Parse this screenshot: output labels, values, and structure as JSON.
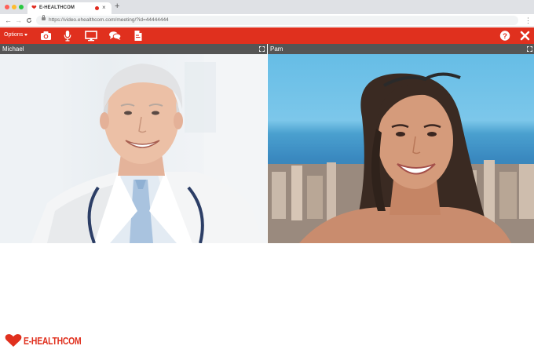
{
  "browser": {
    "tab_title": "E-HEALTHCOM",
    "tab_close": "×",
    "new_tab": "+",
    "url": "https://video.ehealthcom.com/meeting/?id=44444444",
    "menu": "⋮",
    "nav": {
      "back": "←",
      "forward": "→",
      "reload": "C"
    }
  },
  "toolbar": {
    "options_label": "Options",
    "icons": [
      "camera-icon",
      "microphone-icon",
      "screen-share-icon",
      "chat-icon",
      "document-icon",
      "help-icon",
      "close-icon"
    ],
    "background": "#e0301e"
  },
  "videos": {
    "left": {
      "name": "Michael"
    },
    "right": {
      "name": "Pam"
    }
  },
  "brand": {
    "logo_text": "E-HEALTHCOM",
    "color": "#e0301e"
  }
}
